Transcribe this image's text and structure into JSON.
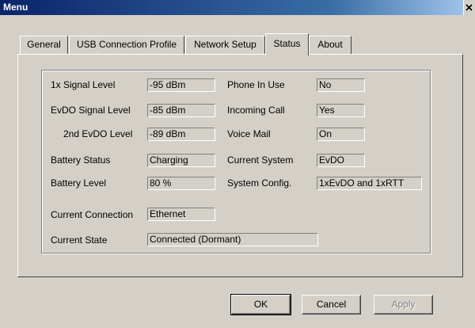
{
  "window": {
    "title": "Menu"
  },
  "tabs": [
    {
      "label": "General"
    },
    {
      "label": "USB Connection Profile"
    },
    {
      "label": "Network Setup"
    },
    {
      "label": "Status"
    },
    {
      "label": "About"
    }
  ],
  "status": {
    "signal_1x_label": "1x Signal Level",
    "signal_1x_value": "-95 dBm",
    "evdo_signal_label": "EvDO Signal Level",
    "evdo_signal_value": "-85 dBm",
    "evdo2_label": "2nd EvDO Level",
    "evdo2_value": "-89 dBm",
    "battery_status_label": "Battery Status",
    "battery_status_value": "Charging",
    "battery_level_label": "Battery Level",
    "battery_level_value": "80 %",
    "phone_in_use_label": "Phone In Use",
    "phone_in_use_value": "No",
    "incoming_call_label": "Incoming Call",
    "incoming_call_value": "Yes",
    "voice_mail_label": "Voice Mail",
    "voice_mail_value": "On",
    "current_system_label": "Current System",
    "current_system_value": "EvDO",
    "system_config_label": "System Config.",
    "system_config_value": "1xEvDO and 1xRTT",
    "current_connection_label": "Current Connection",
    "current_connection_value": "Ethernet",
    "current_state_label": "Current State",
    "current_state_value": "Connected (Dormant)"
  },
  "buttons": {
    "ok": "OK",
    "cancel": "Cancel",
    "apply": "Apply"
  }
}
